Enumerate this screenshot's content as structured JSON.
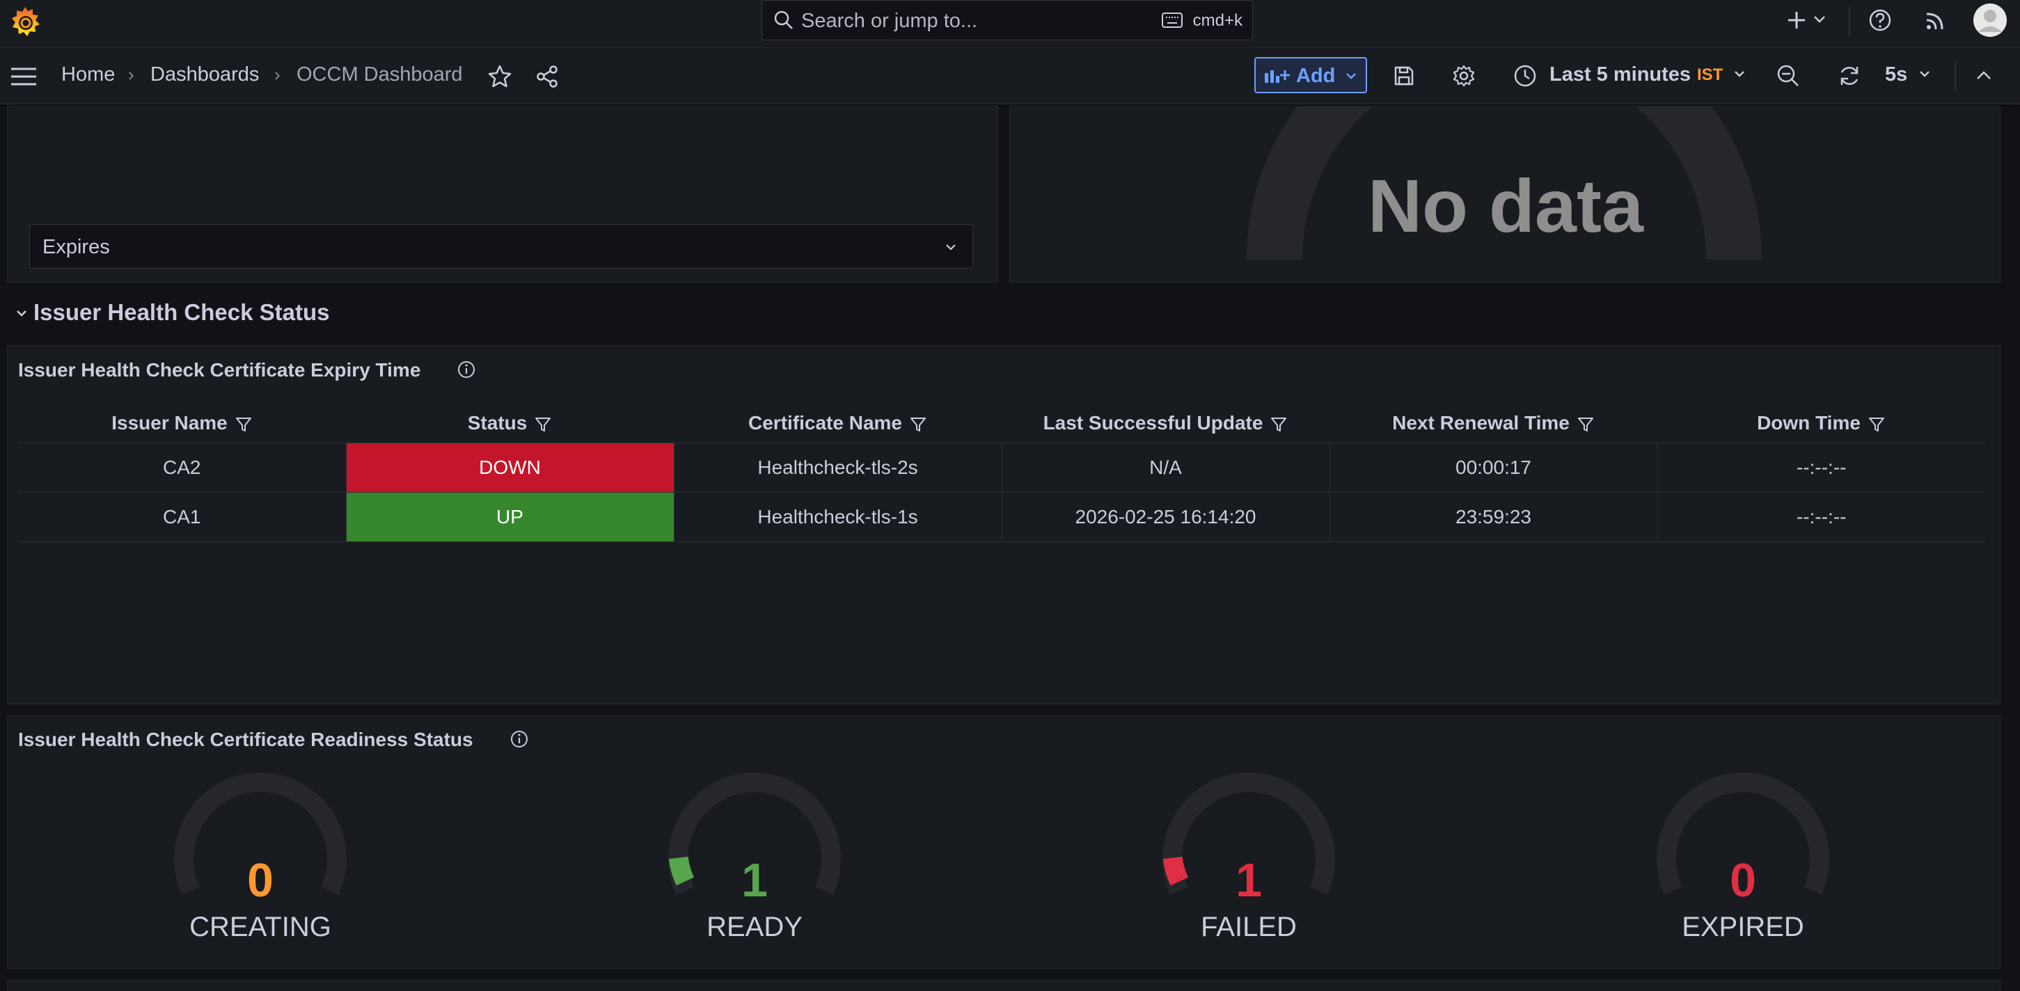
{
  "topbar": {
    "search_placeholder": "Search or jump to...",
    "search_shortcut": "cmd+k",
    "icons": [
      "grafana-logo",
      "search-icon",
      "keyboard-icon",
      "plus-icon",
      "help-icon",
      "rss-icon",
      "user-avatar"
    ]
  },
  "navbar": {
    "breadcrumbs": [
      "Home",
      "Dashboards",
      "OCCM Dashboard"
    ],
    "add_label": "Add",
    "time_range": "Last 5 minutes",
    "timezone": "IST",
    "refresh_interval": "5s"
  },
  "top_left_panel": {
    "select_value": "Expires"
  },
  "top_right_panel": {
    "no_data": "No data"
  },
  "row": {
    "title": "Issuer Health Check Status"
  },
  "expiry_panel": {
    "title": "Issuer Health Check Certificate Expiry Time",
    "columns": [
      "Issuer Name",
      "Status",
      "Certificate Name",
      "Last Successful Update",
      "Next Renewal Time",
      "Down Time"
    ],
    "rows": [
      {
        "issuer": "CA2",
        "status": "DOWN",
        "certificate": "Healthcheck-tls-2s",
        "last_update": "N/A",
        "next_renewal": "00:00:17",
        "down_time": "--:--:--"
      },
      {
        "issuer": "CA1",
        "status": "UP",
        "certificate": "Healthcheck-tls-1s",
        "last_update": "2026-02-25 16:14:20",
        "next_renewal": "23:59:23",
        "down_time": "--:--:--"
      }
    ]
  },
  "readiness_panel": {
    "title": "Issuer Health Check Certificate Readiness Status",
    "gauges": [
      {
        "value": "0",
        "label": "CREATING",
        "color": "#ff9830",
        "fill": 0,
        "arc_color": ""
      },
      {
        "value": "1",
        "label": "READY",
        "color": "#56a64b",
        "fill": 0.08,
        "arc_color": "#56a64b"
      },
      {
        "value": "1",
        "label": "FAILED",
        "color": "#e02f44",
        "fill": 0.08,
        "arc_color": "#e02f44"
      },
      {
        "value": "0",
        "label": "EXPIRED",
        "color": "#e02f44",
        "fill": 0,
        "arc_color": ""
      }
    ]
  },
  "colors": {
    "accent": "#6e9fff",
    "down": "#c4162a",
    "up": "#37872d",
    "warning": "#ff9830"
  }
}
